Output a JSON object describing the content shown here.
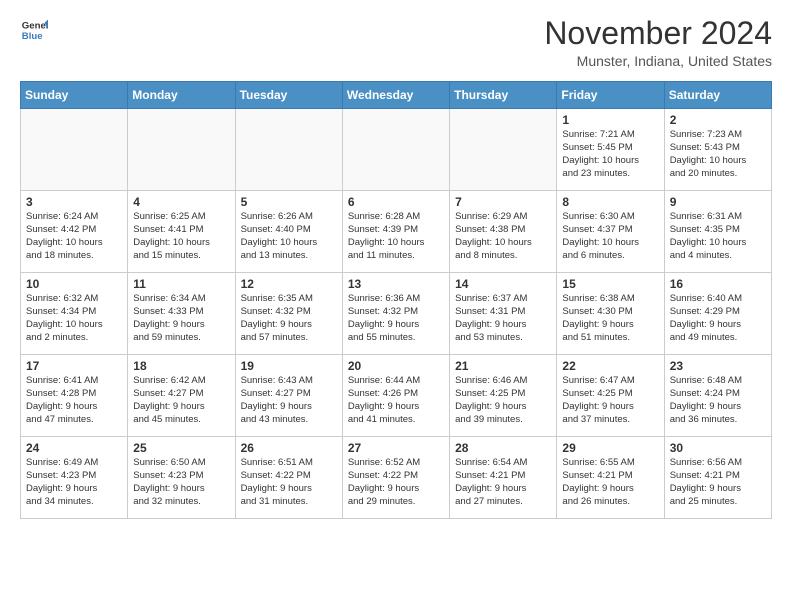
{
  "logo": {
    "line1": "General",
    "line2": "Blue"
  },
  "title": "November 2024",
  "location": "Munster, Indiana, United States",
  "weekdays": [
    "Sunday",
    "Monday",
    "Tuesday",
    "Wednesday",
    "Thursday",
    "Friday",
    "Saturday"
  ],
  "weeks": [
    [
      {
        "day": "",
        "text": ""
      },
      {
        "day": "",
        "text": ""
      },
      {
        "day": "",
        "text": ""
      },
      {
        "day": "",
        "text": ""
      },
      {
        "day": "",
        "text": ""
      },
      {
        "day": "1",
        "text": "Sunrise: 7:21 AM\nSunset: 5:45 PM\nDaylight: 10 hours\nand 23 minutes."
      },
      {
        "day": "2",
        "text": "Sunrise: 7:23 AM\nSunset: 5:43 PM\nDaylight: 10 hours\nand 20 minutes."
      }
    ],
    [
      {
        "day": "3",
        "text": "Sunrise: 6:24 AM\nSunset: 4:42 PM\nDaylight: 10 hours\nand 18 minutes."
      },
      {
        "day": "4",
        "text": "Sunrise: 6:25 AM\nSunset: 4:41 PM\nDaylight: 10 hours\nand 15 minutes."
      },
      {
        "day": "5",
        "text": "Sunrise: 6:26 AM\nSunset: 4:40 PM\nDaylight: 10 hours\nand 13 minutes."
      },
      {
        "day": "6",
        "text": "Sunrise: 6:28 AM\nSunset: 4:39 PM\nDaylight: 10 hours\nand 11 minutes."
      },
      {
        "day": "7",
        "text": "Sunrise: 6:29 AM\nSunset: 4:38 PM\nDaylight: 10 hours\nand 8 minutes."
      },
      {
        "day": "8",
        "text": "Sunrise: 6:30 AM\nSunset: 4:37 PM\nDaylight: 10 hours\nand 6 minutes."
      },
      {
        "day": "9",
        "text": "Sunrise: 6:31 AM\nSunset: 4:35 PM\nDaylight: 10 hours\nand 4 minutes."
      }
    ],
    [
      {
        "day": "10",
        "text": "Sunrise: 6:32 AM\nSunset: 4:34 PM\nDaylight: 10 hours\nand 2 minutes."
      },
      {
        "day": "11",
        "text": "Sunrise: 6:34 AM\nSunset: 4:33 PM\nDaylight: 9 hours\nand 59 minutes."
      },
      {
        "day": "12",
        "text": "Sunrise: 6:35 AM\nSunset: 4:32 PM\nDaylight: 9 hours\nand 57 minutes."
      },
      {
        "day": "13",
        "text": "Sunrise: 6:36 AM\nSunset: 4:32 PM\nDaylight: 9 hours\nand 55 minutes."
      },
      {
        "day": "14",
        "text": "Sunrise: 6:37 AM\nSunset: 4:31 PM\nDaylight: 9 hours\nand 53 minutes."
      },
      {
        "day": "15",
        "text": "Sunrise: 6:38 AM\nSunset: 4:30 PM\nDaylight: 9 hours\nand 51 minutes."
      },
      {
        "day": "16",
        "text": "Sunrise: 6:40 AM\nSunset: 4:29 PM\nDaylight: 9 hours\nand 49 minutes."
      }
    ],
    [
      {
        "day": "17",
        "text": "Sunrise: 6:41 AM\nSunset: 4:28 PM\nDaylight: 9 hours\nand 47 minutes."
      },
      {
        "day": "18",
        "text": "Sunrise: 6:42 AM\nSunset: 4:27 PM\nDaylight: 9 hours\nand 45 minutes."
      },
      {
        "day": "19",
        "text": "Sunrise: 6:43 AM\nSunset: 4:27 PM\nDaylight: 9 hours\nand 43 minutes."
      },
      {
        "day": "20",
        "text": "Sunrise: 6:44 AM\nSunset: 4:26 PM\nDaylight: 9 hours\nand 41 minutes."
      },
      {
        "day": "21",
        "text": "Sunrise: 6:46 AM\nSunset: 4:25 PM\nDaylight: 9 hours\nand 39 minutes."
      },
      {
        "day": "22",
        "text": "Sunrise: 6:47 AM\nSunset: 4:25 PM\nDaylight: 9 hours\nand 37 minutes."
      },
      {
        "day": "23",
        "text": "Sunrise: 6:48 AM\nSunset: 4:24 PM\nDaylight: 9 hours\nand 36 minutes."
      }
    ],
    [
      {
        "day": "24",
        "text": "Sunrise: 6:49 AM\nSunset: 4:23 PM\nDaylight: 9 hours\nand 34 minutes."
      },
      {
        "day": "25",
        "text": "Sunrise: 6:50 AM\nSunset: 4:23 PM\nDaylight: 9 hours\nand 32 minutes."
      },
      {
        "day": "26",
        "text": "Sunrise: 6:51 AM\nSunset: 4:22 PM\nDaylight: 9 hours\nand 31 minutes."
      },
      {
        "day": "27",
        "text": "Sunrise: 6:52 AM\nSunset: 4:22 PM\nDaylight: 9 hours\nand 29 minutes."
      },
      {
        "day": "28",
        "text": "Sunrise: 6:54 AM\nSunset: 4:21 PM\nDaylight: 9 hours\nand 27 minutes."
      },
      {
        "day": "29",
        "text": "Sunrise: 6:55 AM\nSunset: 4:21 PM\nDaylight: 9 hours\nand 26 minutes."
      },
      {
        "day": "30",
        "text": "Sunrise: 6:56 AM\nSunset: 4:21 PM\nDaylight: 9 hours\nand 25 minutes."
      }
    ]
  ]
}
